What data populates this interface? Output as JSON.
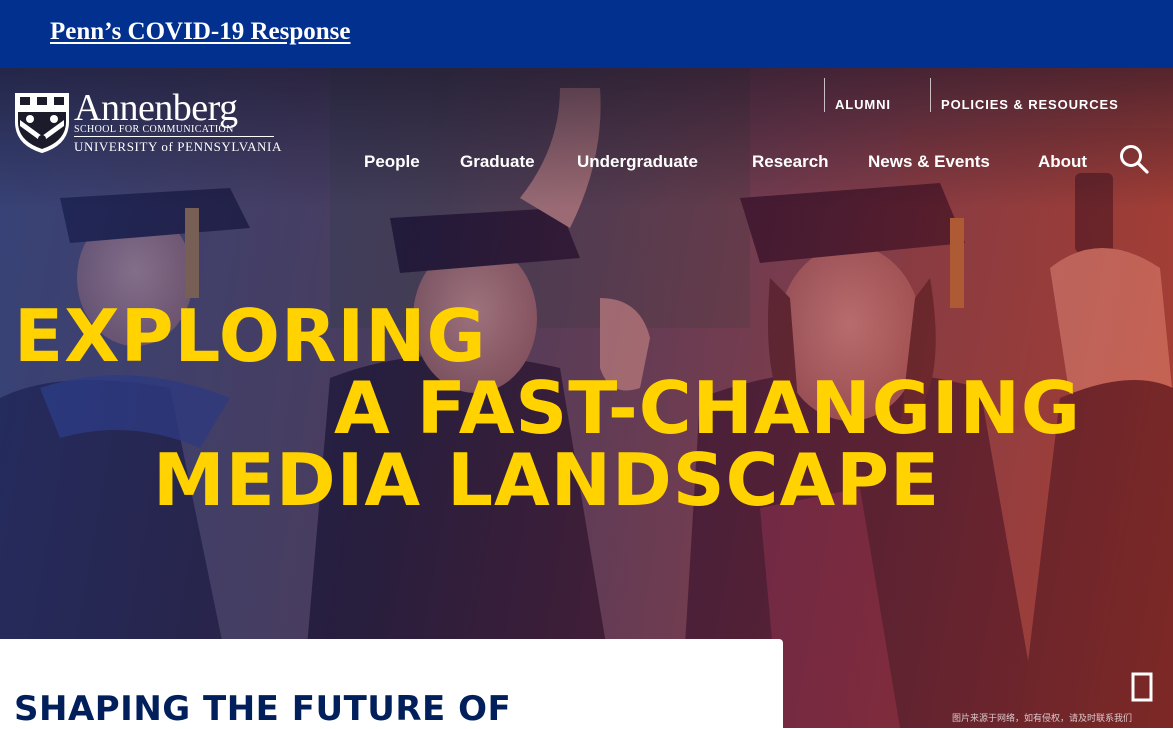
{
  "alert": {
    "link_text": "Penn’s COVID-19 Response"
  },
  "logo": {
    "name": "Annenberg",
    "school": "SCHOOL FOR COMMUNICATION",
    "university": "UNIVERSITY of PENNSYLVANIA",
    "icon": "penn-shield-icon"
  },
  "utility_nav": {
    "items": [
      "ALUMNI",
      "POLICIES & RESOURCES"
    ]
  },
  "main_nav": {
    "items": [
      "People",
      "Graduate",
      "Undergraduate",
      "Research",
      "News & Events",
      "About"
    ],
    "search_icon": "search-icon"
  },
  "hero": {
    "headline_line1": "EXPLORING",
    "headline_line2": "A FAST-CHANGING",
    "headline_line3": "MEDIA LANDSCAPE",
    "pause_icon": "pause-icon"
  },
  "intro": {
    "heading": "SHAPING THE FUTURE OF"
  },
  "watermark": {
    "text": "图片来源于网络，如有侵权，请及时联系我们"
  },
  "colors": {
    "alert_bg": "#01308f",
    "headline": "#ffd200",
    "intro_heading": "#011f5b"
  }
}
